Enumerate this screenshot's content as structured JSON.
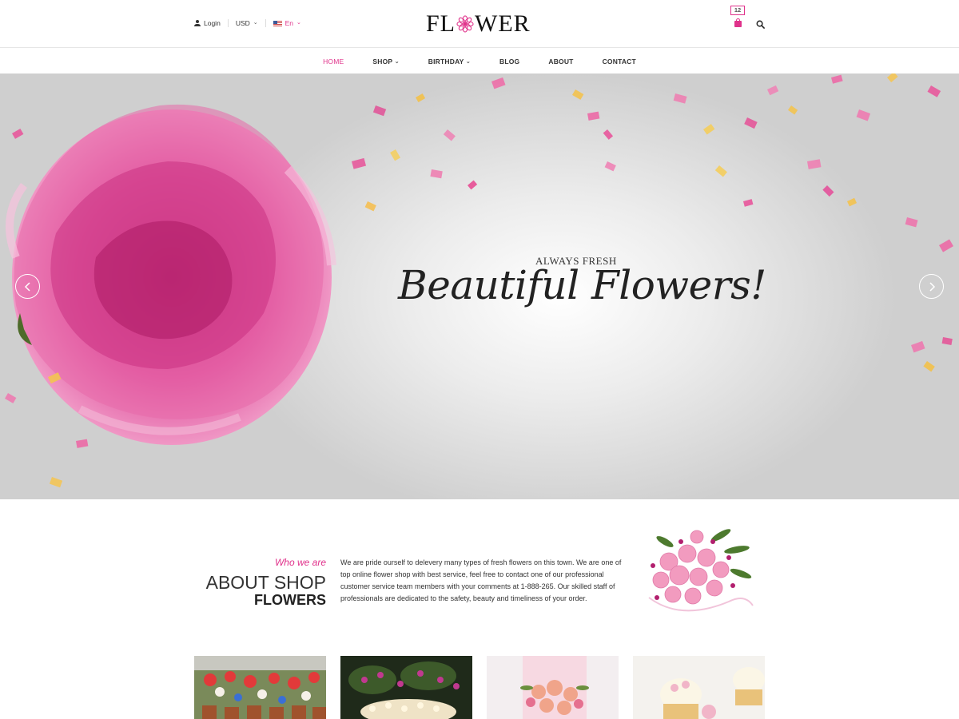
{
  "topbar": {
    "login_label": "Login",
    "currency": "USD",
    "language": "En",
    "cart_count": "12",
    "icons": [
      "user-icon",
      "chevron-down-icon",
      "flag-icon",
      "bag-icon",
      "search-icon"
    ]
  },
  "logo": {
    "text_before": "FL",
    "text_after": "WER"
  },
  "nav": {
    "items": [
      {
        "label": "HOME",
        "active": true
      },
      {
        "label": "SHOP",
        "has_dropdown": true
      },
      {
        "label": "BIRTHDAY",
        "has_dropdown": true
      },
      {
        "label": "BLOG"
      },
      {
        "label": "ABOUT"
      },
      {
        "label": "CONTACT"
      }
    ]
  },
  "hero": {
    "subtitle": "ALWAYS FRESH",
    "title": "Beautiful Flowers!",
    "prev_icon": "chevron-left-icon",
    "next_icon": "chevron-right-icon"
  },
  "about": {
    "who": "Who we are",
    "title": "ABOUT SHOP",
    "title_strong": "FLOWERS",
    "text": "We are pride ourself to delevery many types of fresh flowers on this town. We are one of top online flower shop with best service,  feel free to contact one of our professional customer service team members with your comments at 1-888-265. Our skilled staff of professionals are dedicated to the safety, beauty and timeliness of your order."
  },
  "gallery": [
    "flower-pots-image",
    "flower-garden-image",
    "bridal-bouquet-image",
    "cupcakes-image"
  ],
  "colors": {
    "accent": "#e0328b",
    "text": "#333333"
  }
}
